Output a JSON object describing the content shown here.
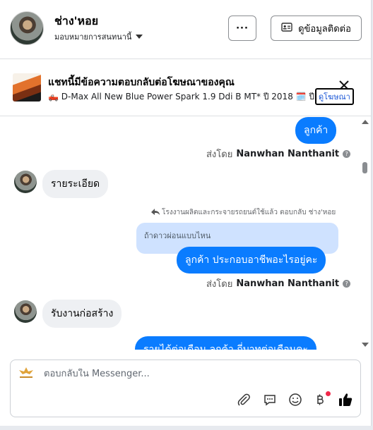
{
  "header": {
    "contact_name": "ช่าง'หอย",
    "assignee_label": "มอบหมายการสนทนานี้",
    "more_label": "···",
    "view_contact_label": "ดูข้อมูลติดต่อ"
  },
  "ad_banner": {
    "title": "แชทนี้มีข้อความตอบกลับต่อโฆษณาของคุณ",
    "subtitle": "D-Max All New Blue Power Spark 1.9 Ddi B MT* ปี 2018 🗓️ ปี : 2...",
    "view_ad_label": "ดูโฆษณา"
  },
  "messages": {
    "out_1": "ลูกค้า",
    "sent_by_prefix": "ส่งโดย",
    "sender_name": "Nanwhan Nanthanit",
    "in_1": "รายระเอียด",
    "reply_note": "โรงงานผลิตและกระจายรถยนต์ใช้แล้ว ตอบกลับ ช่าง'หอย",
    "quoted_text": "ถ้าดาวผ่อนแบบไหน",
    "out_2": "ลูกค้า  ประกอบอาชีพอะไรอยู่คะ",
    "in_2": "รับงานก่อสร้าง",
    "out_3_partial": "รายได้ต่อเดือน  ลูกค้า  ถี่บาทต่อเดือนคะ"
  },
  "composer": {
    "placeholder": "ตอบกลับใน Messenger..."
  },
  "colors": {
    "outgoing_bubble": "#0a7cff",
    "incoming_bubble": "#eef0f3",
    "quoted_bubble": "#cfe2ff",
    "link": "#1a56d6"
  },
  "icons": [
    "caret-down-icon",
    "id-card-icon",
    "close-icon",
    "reply-arrow-icon",
    "info-icon",
    "attach-icon",
    "saved-reply-icon",
    "emoji-icon",
    "baht-icon",
    "like-icon"
  ]
}
